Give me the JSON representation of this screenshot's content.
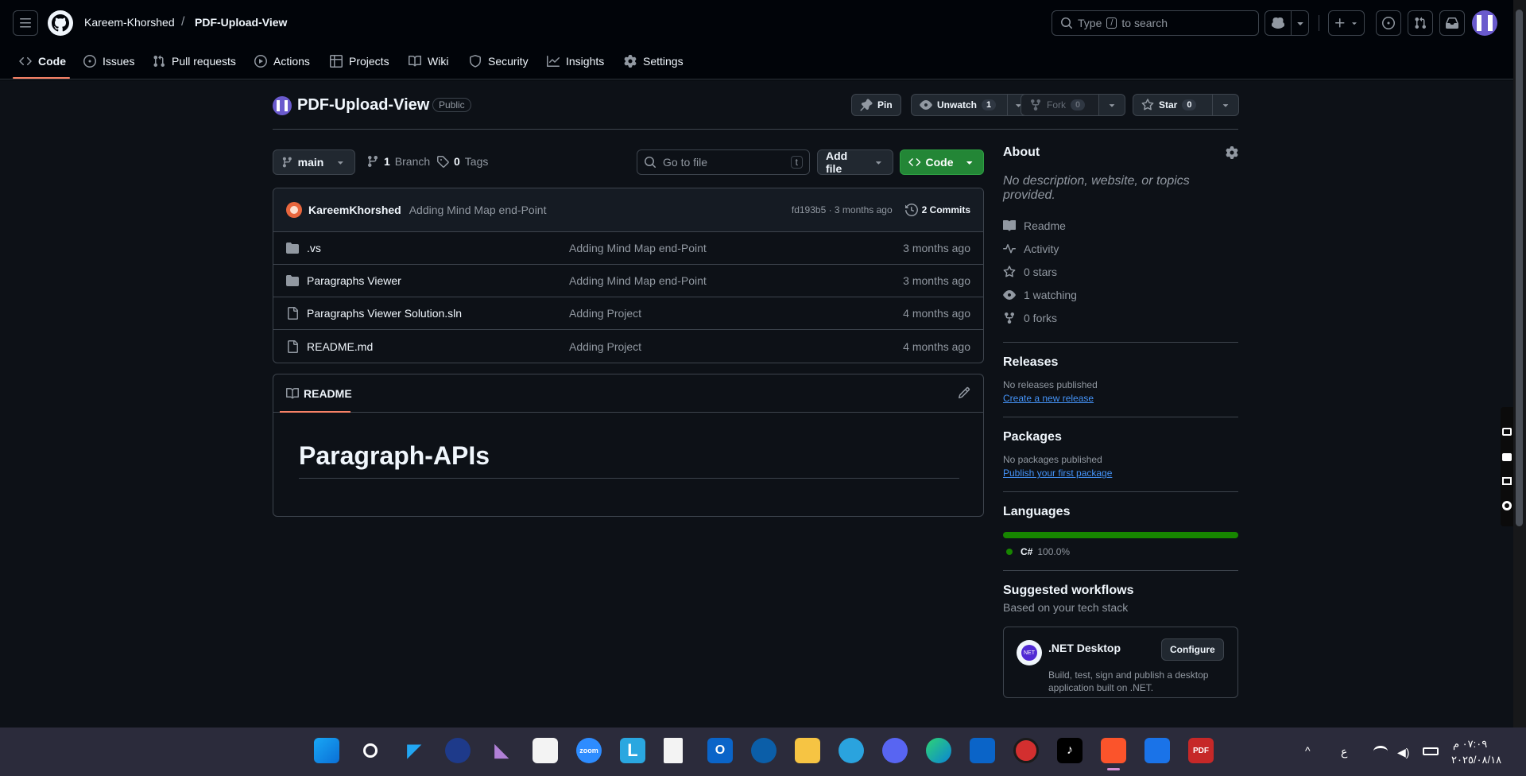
{
  "header": {
    "owner": "Kareem-Khorshed",
    "separator": "/",
    "repo": "PDF-Upload-View",
    "search_prefix": "Type",
    "search_key": "/",
    "search_suffix": "to search"
  },
  "nav_tabs": [
    {
      "label": "Code",
      "icon": "code-icon"
    },
    {
      "label": "Issues",
      "icon": "issue-icon"
    },
    {
      "label": "Pull requests",
      "icon": "pull-request-icon"
    },
    {
      "label": "Actions",
      "icon": "play-icon"
    },
    {
      "label": "Projects",
      "icon": "table-icon"
    },
    {
      "label": "Wiki",
      "icon": "book-icon"
    },
    {
      "label": "Security",
      "icon": "shield-icon"
    },
    {
      "label": "Insights",
      "icon": "graph-icon"
    },
    {
      "label": "Settings",
      "icon": "gear-icon"
    }
  ],
  "repo_header": {
    "name": "PDF-Upload-View",
    "visibility": "Public",
    "pin": "Pin",
    "unwatch": "Unwatch",
    "watch_count": "1",
    "fork": "Fork",
    "fork_count": "0",
    "star": "Star",
    "star_count": "0"
  },
  "toolbar": {
    "branch": "main",
    "branch_count": "1",
    "branch_label": "Branch",
    "tag_count": "0",
    "tag_label": "Tags",
    "goto_placeholder": "Go to file",
    "goto_key": "t",
    "add_file": "Add file",
    "code": "Code"
  },
  "commit": {
    "author": "KareemKhorshed",
    "message": "Adding Mind Map end-Point",
    "hash_time": "fd193b5 · 3 months ago",
    "commits": "2 Commits"
  },
  "files": [
    {
      "type": "folder",
      "name": ".vs",
      "message": "Adding Mind Map end-Point",
      "time": "3 months ago"
    },
    {
      "type": "folder",
      "name": "Paragraphs Viewer",
      "message": "Adding Mind Map end-Point",
      "time": "3 months ago"
    },
    {
      "type": "file",
      "name": "Paragraphs Viewer Solution.sln",
      "message": "Adding Project",
      "time": "4 months ago"
    },
    {
      "type": "file",
      "name": "README.md",
      "message": "Adding Project",
      "time": "4 months ago"
    }
  ],
  "readme": {
    "tab": "README",
    "heading": "Paragraph-APIs"
  },
  "about": {
    "title": "About",
    "description": "No description, website, or topics provided.",
    "items": [
      {
        "icon": "book-icon",
        "label": "Readme"
      },
      {
        "icon": "pulse-icon",
        "label": "Activity"
      },
      {
        "icon": "star-icon",
        "label": "0 stars"
      },
      {
        "icon": "eye-icon",
        "label": "1 watching"
      },
      {
        "icon": "fork-icon",
        "label": "0 forks"
      }
    ]
  },
  "releases": {
    "title": "Releases",
    "text": "No releases published",
    "link": "Create a new release"
  },
  "packages": {
    "title": "Packages",
    "text": "No packages published",
    "link": "Publish your first package"
  },
  "languages": {
    "title": "Languages",
    "name": "C#",
    "percent": "100.0%",
    "color": "#178600"
  },
  "workflows": {
    "title": "Suggested workflows",
    "subtitle": "Based on your tech stack",
    "card_title": ".NET Desktop",
    "card_badge": "NET",
    "configure": "Configure",
    "card_desc_1": "Build, test, sign and publish a desktop",
    "card_desc_2": "application built on .NET."
  },
  "taskbar": {
    "time": "٠٧:٠٩ م",
    "date": "٢٠٢٥/٠٨/١٨",
    "lang": "ع"
  },
  "colors": {
    "accent_green": "#238636",
    "link_blue": "#4493f8",
    "tab_underline": "#f78166"
  }
}
